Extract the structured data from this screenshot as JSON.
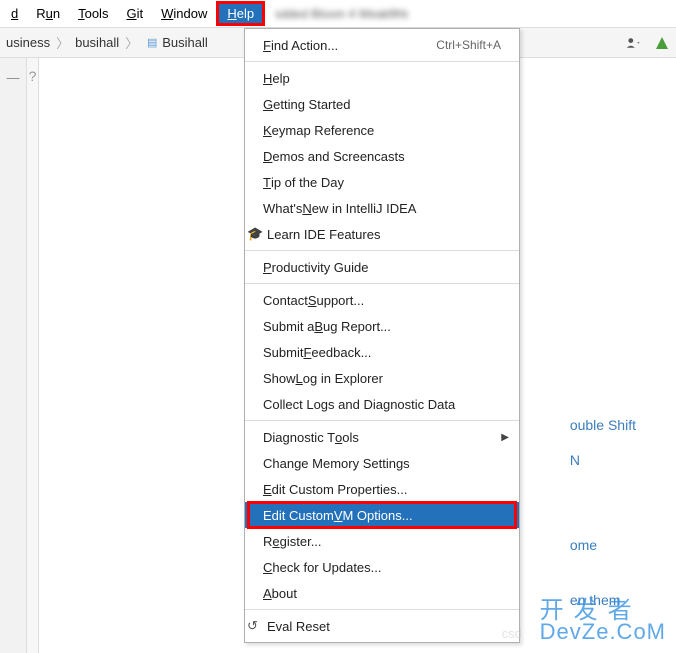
{
  "menubar": {
    "items": [
      {
        "pre": "",
        "key": "d",
        "post": ""
      },
      {
        "pre": "R",
        "key": "u",
        "post": "n"
      },
      {
        "pre": "",
        "key": "T",
        "post": "ools"
      },
      {
        "pre": "",
        "key": "G",
        "post": "it"
      },
      {
        "pre": "",
        "key": "W",
        "post": "indow"
      },
      {
        "pre": "",
        "key": "H",
        "post": "elp"
      }
    ],
    "tail": "sdded Bloom 4 Weakfifrk"
  },
  "breadcrumb": {
    "items": [
      "usiness",
      "busihall",
      "Busihall"
    ]
  },
  "help_menu": {
    "find_action": {
      "pre": "",
      "key": "F",
      "post": "ind Action...",
      "shortcut": "Ctrl+Shift+A"
    },
    "groups": [
      [
        {
          "pre": "",
          "key": "H",
          "post": "elp"
        },
        {
          "pre": "",
          "key": "G",
          "post": "etting Started"
        },
        {
          "pre": "",
          "key": "K",
          "post": "eymap Reference"
        },
        {
          "pre": "",
          "key": "D",
          "post": "emos and Screencasts"
        },
        {
          "pre": "",
          "key": "T",
          "post": "ip of the Day"
        },
        {
          "pre": "What's ",
          "key": "N",
          "post": "ew in IntelliJ IDEA"
        },
        {
          "pre": "Learn IDE Features",
          "key": "",
          "post": "",
          "icon": "cap"
        }
      ],
      [
        {
          "pre": "",
          "key": "P",
          "post": "roductivity Guide"
        }
      ],
      [
        {
          "pre": "Contact ",
          "key": "S",
          "post": "upport..."
        },
        {
          "pre": "Submit a ",
          "key": "B",
          "post": "ug Report..."
        },
        {
          "pre": "Submit ",
          "key": "F",
          "post": "eedback..."
        },
        {
          "pre": "Show ",
          "key": "L",
          "post": "og in Explorer"
        },
        {
          "pre": "Collect Logs and Diagnostic Data",
          "key": "",
          "post": ""
        }
      ],
      [
        {
          "pre": "Diagnostic T",
          "key": "o",
          "post": "ols",
          "submenu": true
        },
        {
          "pre": "Change Memory Settings",
          "key": "",
          "post": ""
        },
        {
          "pre": "",
          "key": "E",
          "post": "dit Custom Properties..."
        },
        {
          "pre": "Edit Custom ",
          "key": "V",
          "post": "M Options...",
          "selected": true,
          "boxed": true
        },
        {
          "pre": "R",
          "key": "e",
          "post": "gister..."
        },
        {
          "pre": "",
          "key": "C",
          "post": "heck for Updates..."
        },
        {
          "pre": "",
          "key": "A",
          "post": "bout"
        }
      ],
      [
        {
          "pre": "Eval Reset",
          "key": "",
          "post": "",
          "icon": "reset"
        }
      ]
    ]
  },
  "hints": {
    "a": "ouble Shift",
    "b": "N",
    "c": "ome",
    "d": "en them"
  },
  "watermark": {
    "cs": "csd",
    "cn": "开发者",
    "en": "DevZe.CoM"
  }
}
